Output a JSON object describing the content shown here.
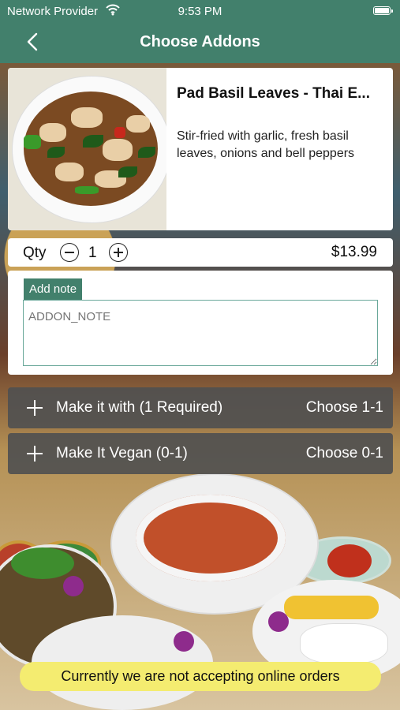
{
  "status_bar": {
    "carrier": "Network Provider",
    "time": "9:53 PM"
  },
  "nav": {
    "title": "Choose Addons",
    "back_icon": "chevron-left-icon"
  },
  "item": {
    "name": "Pad Basil Leaves - Thai E...",
    "description": "Stir-fried with garlic, fresh basil leaves, onions and bell peppers"
  },
  "quantity": {
    "label": "Qty",
    "value": "1",
    "price": "$13.99"
  },
  "note": {
    "tag": "Add note",
    "placeholder": "ADDON_NOTE"
  },
  "addons": [
    {
      "label": "Make it with (1 Required)",
      "choose": "Choose 1-1"
    },
    {
      "label": "Make It Vegan (0-1)",
      "choose": "Choose 0-1"
    }
  ],
  "banner": {
    "text": "Currently we are not accepting online orders"
  },
  "colors": {
    "accent": "#42806c",
    "banner": "#f4ec70",
    "addon_row": "#505050"
  }
}
